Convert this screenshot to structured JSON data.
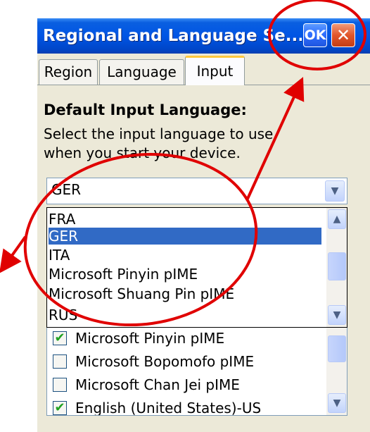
{
  "window": {
    "title": "Regional and Language Se...",
    "ok_label": "OK",
    "close_label": "✕"
  },
  "tabs": [
    {
      "label": "Region",
      "active": false
    },
    {
      "label": "Language",
      "active": false
    },
    {
      "label": "Input",
      "active": true
    }
  ],
  "section": {
    "heading": "Default Input Language:",
    "description": "Select the input language to use when you start your device."
  },
  "combo": {
    "selected_value": "GER",
    "arrow_icon": "chevron-down-icon"
  },
  "dropdown": {
    "options": [
      "FRA",
      "GER",
      "ITA",
      "Microsoft Pinyin pIME",
      "Microsoft Shuang Pin pIME",
      "RUS"
    ],
    "highlighted": "GER",
    "highlight_color": "#316ac5"
  },
  "installed_list": {
    "items": [
      {
        "label": "Microsoft Pinyin pIME",
        "checked": true
      },
      {
        "label": "Microsoft Bopomofo pIME",
        "checked": false
      },
      {
        "label": "Microsoft Chan Jei pIME",
        "checked": false
      },
      {
        "label": "English (United States)-US",
        "checked": true
      }
    ]
  },
  "colors": {
    "titlebar": "#0055e5",
    "dialog_bg": "#ece9d8",
    "annotation_red": "#e00000",
    "active_tab_accent": "#ffc83c"
  }
}
